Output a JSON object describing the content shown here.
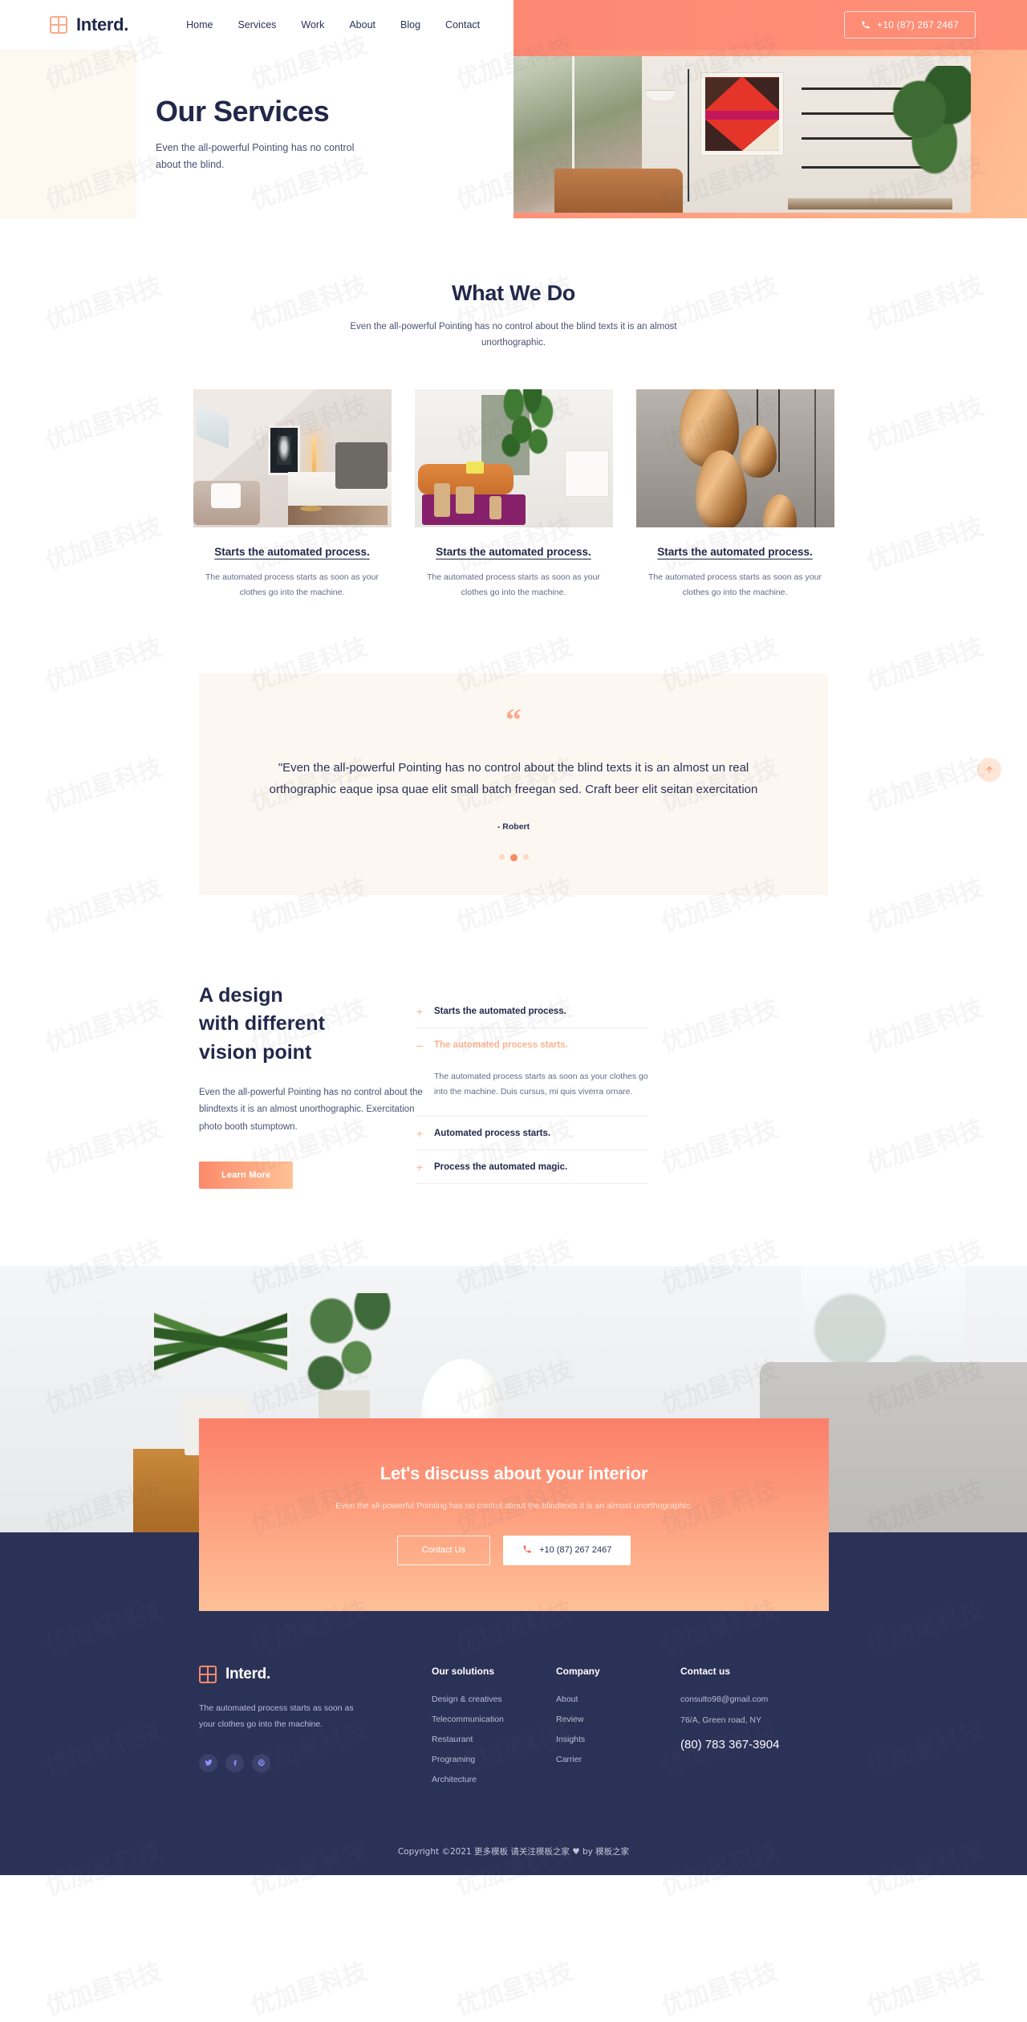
{
  "brand": {
    "name": "Interd.",
    "logo_icon": "grid-square-icon"
  },
  "nav": {
    "items": [
      {
        "label": "Home"
      },
      {
        "label": "Services"
      },
      {
        "label": "Work"
      },
      {
        "label": "About"
      },
      {
        "label": "Blog"
      },
      {
        "label": "Contact"
      }
    ],
    "phone_button": {
      "label": "+10 (87) 267 2467",
      "icon": "phone-icon"
    }
  },
  "hero": {
    "title": "Our Services",
    "subtitle": "Even the all-powerful Pointing has no control about the blind."
  },
  "what_we_do": {
    "title": "What We Do",
    "subtitle": "Even the all-powerful Pointing has no control about the blind texts it is an almost unorthographic.",
    "cards": [
      {
        "title": "Starts the automated process.",
        "text": "The automated process starts as soon as your clothes go into the machine.",
        "image_alt": "bedroom-interior-photo"
      },
      {
        "title": "Starts the automated process.",
        "text": "The automated process starts as soon as your clothes go into the machine.",
        "image_alt": "lounge-room-with-plant-photo"
      },
      {
        "title": "Starts the automated process.",
        "text": "The automated process starts as soon as your clothes go into the machine.",
        "image_alt": "copper-pendant-lamps-photo"
      }
    ]
  },
  "scroll_top": {
    "icon": "arrow-up-icon"
  },
  "testimonial": {
    "quote_icon": "quote-mark-icon",
    "quote": "\"Even the all-powerful Pointing has no control about the blind texts it is an almost un real orthographic eaque ipsa quae elit small batch freegan sed. Craft beer elit seitan exercitation",
    "author": "- Robert",
    "dots": [
      {
        "active": false
      },
      {
        "active": true
      },
      {
        "active": false
      }
    ]
  },
  "design": {
    "title_lines": [
      "A design",
      "with different",
      "vision point"
    ],
    "text": "Even the all-powerful Pointing has no control about the blindtexts it is an almost unorthographic. Exercitation photo booth stumptown.",
    "button": "Learn More",
    "accordion": [
      {
        "sign": "+",
        "label": "Starts the automated process.",
        "open": false,
        "body": ""
      },
      {
        "sign": "–",
        "label": "The automated process starts.",
        "open": true,
        "body": "The automated process starts as soon as your clothes go into the machine. Duis cursus, mi quis viverra ornare."
      },
      {
        "sign": "+",
        "label": "Automated process starts.",
        "open": false,
        "body": ""
      },
      {
        "sign": "+",
        "label": "Process the automated magic.",
        "open": false,
        "body": ""
      }
    ]
  },
  "cta": {
    "title": "Let's discuss about your interior",
    "subtitle": "Even the all-powerful Pointing has no control about the blindtexts it is an almost unorthographic.",
    "contact_button": "Contact Us",
    "phone_button": "+10 (87) 267 2467",
    "phone_icon": "phone-icon",
    "background_alt": "living-room-sideboard-plants-photo"
  },
  "footer": {
    "brand_text": "The automated process starts as soon as your clothes go into the machine.",
    "socials": [
      {
        "name": "twitter-icon",
        "glyph": "🐦"
      },
      {
        "name": "facebook-icon",
        "glyph": "f"
      },
      {
        "name": "pinterest-icon",
        "glyph": "Ⓟ"
      }
    ],
    "columns": [
      {
        "title": "Our solutions",
        "links": [
          "Design & creatives",
          "Telecommunication",
          "Restaurant",
          "Programing",
          "Architecture"
        ]
      },
      {
        "title": "Company",
        "links": [
          "About",
          "Review",
          "Insights",
          "Carrier"
        ]
      }
    ],
    "contact": {
      "title": "Contact us",
      "email": "consulto98@gmail.com",
      "address": "76/A, Green road, NY",
      "phone": "(80) 783 367-3904"
    },
    "copyright": "Copyright ©2021 更多模板 请关注模板之家 ♥ by 模板之家"
  },
  "watermark": {
    "text": "优加星科技"
  },
  "colors": {
    "accent": "#fb8a6a",
    "accent_light": "#ffc296",
    "navy": "#2b3258",
    "cream": "#fdf7f1"
  }
}
